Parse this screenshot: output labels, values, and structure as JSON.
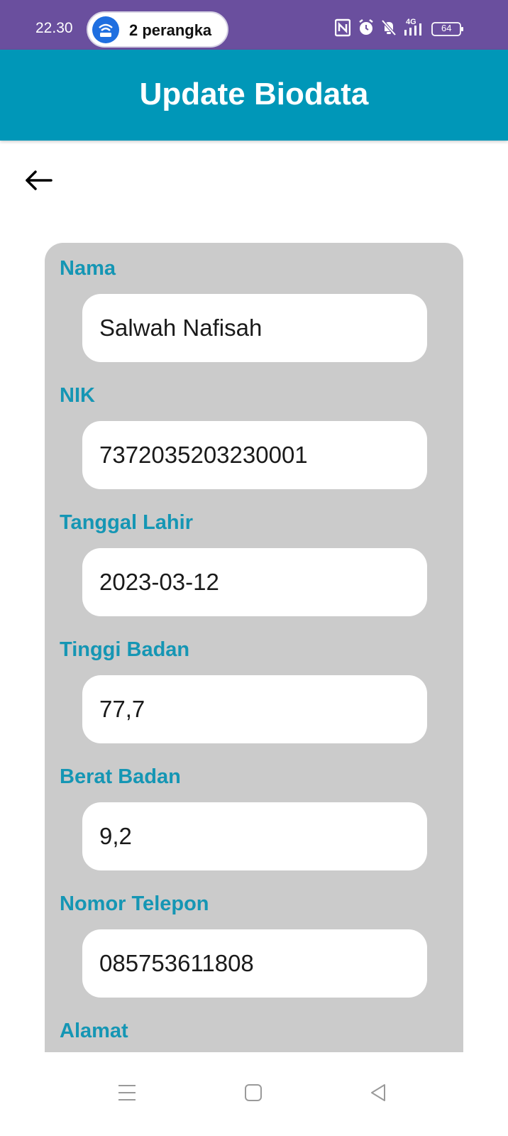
{
  "status_bar": {
    "time": "22.30",
    "hotspot_text": "2 perangka",
    "battery": "64",
    "icons": [
      "nfc-icon",
      "alarm-icon",
      "mute-icon",
      "4g-signal-icon",
      "battery-icon"
    ]
  },
  "app_bar": {
    "title": "Update Biodata"
  },
  "form": {
    "fields": [
      {
        "label": "Nama",
        "value": "Salwah Nafisah"
      },
      {
        "label": "NIK",
        "value": "7372035203230001"
      },
      {
        "label": "Tanggal Lahir",
        "value": "2023-03-12"
      },
      {
        "label": "Tinggi Badan",
        "value": "77,7"
      },
      {
        "label": "Berat Badan",
        "value": "9,2"
      },
      {
        "label": "Nomor Telepon",
        "value": "085753611808"
      },
      {
        "label": "Alamat",
        "value": ""
      }
    ]
  },
  "colors": {
    "status_bar": "#6a4f9e",
    "app_bar": "#0097b8",
    "label": "#1596b4",
    "card": "#cbcbcb"
  }
}
